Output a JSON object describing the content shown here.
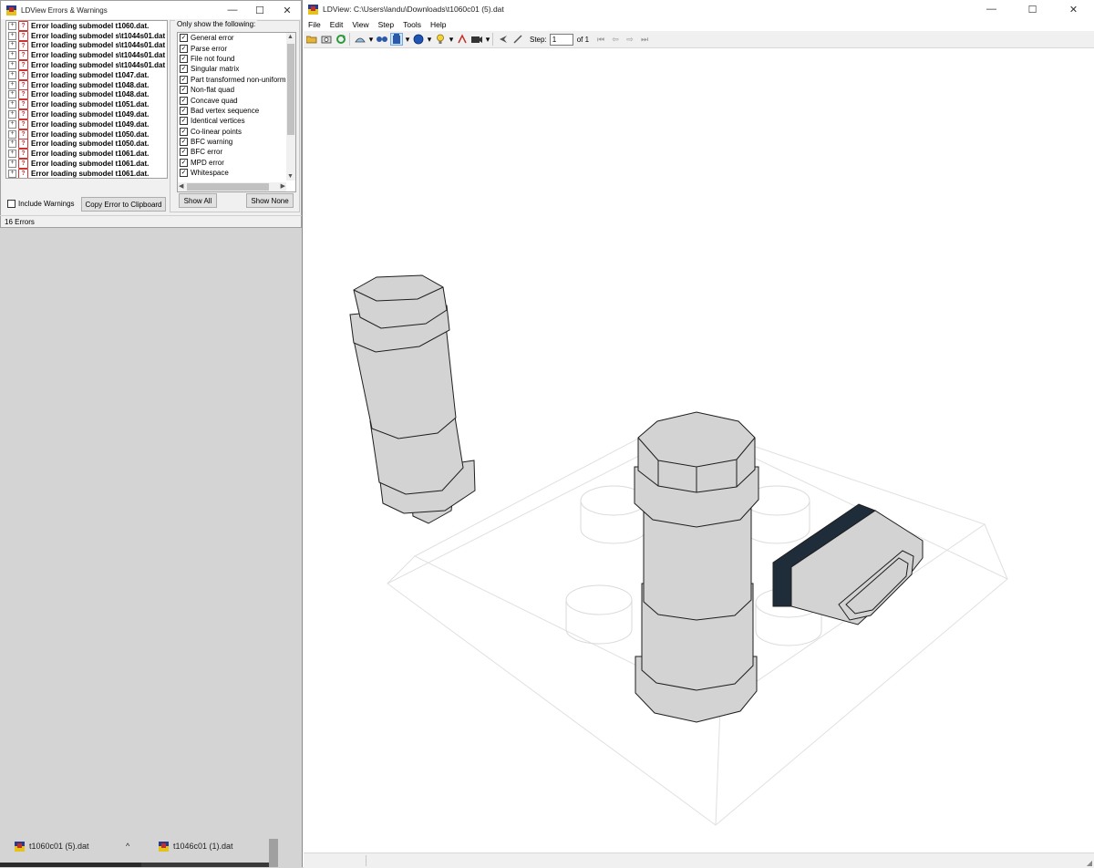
{
  "errors_window": {
    "title": "LDView Errors & Warnings",
    "errors": [
      "Error loading submodel t1060.dat.",
      "Error loading submodel s\\t1044s01.dat",
      "Error loading submodel s\\t1044s01.dat",
      "Error loading submodel s\\t1044s01.dat",
      "Error loading submodel s\\t1044s01.dat",
      "Error loading submodel t1047.dat.",
      "Error loading submodel t1048.dat.",
      "Error loading submodel t1048.dat.",
      "Error loading submodel t1051.dat.",
      "Error loading submodel t1049.dat.",
      "Error loading submodel t1049.dat.",
      "Error loading submodel t1050.dat.",
      "Error loading submodel t1050.dat.",
      "Error loading submodel t1061.dat.",
      "Error loading submodel t1061.dat.",
      "Error loading submodel t1061.dat."
    ],
    "filter_label": "Only show the following:",
    "filters": [
      {
        "label": "General error",
        "checked": true
      },
      {
        "label": "Parse error",
        "checked": true
      },
      {
        "label": "File not found",
        "checked": true
      },
      {
        "label": "Singular matrix",
        "checked": true
      },
      {
        "label": "Part transformed non-uniformly",
        "checked": true
      },
      {
        "label": "Non-flat quad",
        "checked": true
      },
      {
        "label": "Concave quad",
        "checked": true
      },
      {
        "label": "Bad vertex sequence",
        "checked": true
      },
      {
        "label": "Identical vertices",
        "checked": true
      },
      {
        "label": "Co-linear points",
        "checked": true
      },
      {
        "label": "BFC warning",
        "checked": true
      },
      {
        "label": "BFC error",
        "checked": true
      },
      {
        "label": "MPD error",
        "checked": true
      },
      {
        "label": "Whitespace",
        "checked": true
      }
    ],
    "include_warnings_label": "Include Warnings",
    "include_warnings_checked": false,
    "copy_button": "Copy Error to Clipboard",
    "show_all_button": "Show All",
    "show_none_button": "Show None",
    "status": "16 Errors"
  },
  "taskbar": {
    "items": [
      "t1060c01 (5).dat",
      "t1046c01 (1).dat"
    ],
    "chevron": "^"
  },
  "main_window": {
    "title": "LDView: C:\\Users\\landu\\Downloads\\t1060c01 (5).dat",
    "menus": [
      "File",
      "Edit",
      "View",
      "Step",
      "Tools",
      "Help"
    ],
    "step_label": "Step:",
    "step_value": "1",
    "step_total": "of 1"
  },
  "window_controls": {
    "minimize": "—",
    "maximize": "☐",
    "close": "✕"
  },
  "colors": {
    "part_fill": "#d3d3d3",
    "part_stroke": "#1e1e1e",
    "dark_part": "#1f2d3a",
    "plate_line": "#d8d8d8"
  }
}
